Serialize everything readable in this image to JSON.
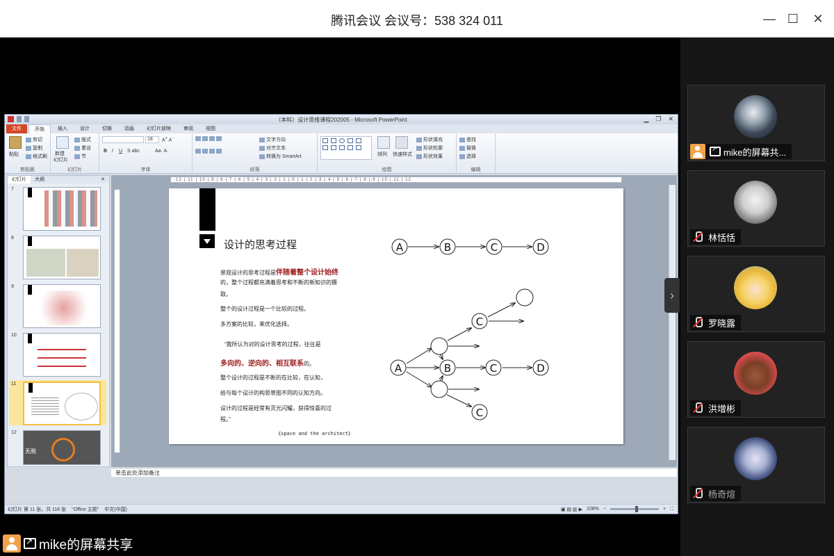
{
  "window": {
    "title": "腾讯会议 会议号：538 324 011",
    "minimize": "—",
    "maximize": "☐",
    "close": "✕"
  },
  "ppt": {
    "title": "（本科）设计思维课程202005 - Microsoft PowerPoint",
    "tabs": [
      "文件",
      "开始",
      "插入",
      "设计",
      "切换",
      "动画",
      "幻灯片放映",
      "审阅",
      "视图"
    ],
    "ribbon": {
      "clipboard": {
        "label": "剪贴板",
        "paste": "粘贴",
        "cut": "剪切",
        "copy": "复制",
        "format": "格式刷"
      },
      "slides": {
        "label": "幻灯片",
        "new": "新建",
        "new2": "幻灯片",
        "layout": "版式",
        "reset": "重设",
        "section": "节"
      },
      "font": {
        "label": "字体",
        "size": "18"
      },
      "paragraph": {
        "label": "段落",
        "dir": "文字方向",
        "align": "对齐文本",
        "smartart": "转换为 SmartArt"
      },
      "drawing": {
        "label": "绘图",
        "arrange": "排列",
        "quick": "快速样式",
        "fill": "形状填充",
        "outline": "形状轮廓",
        "effect": "形状效果"
      },
      "editing": {
        "label": "编辑",
        "find": "查找",
        "replace": "替换",
        "select": "选择"
      }
    },
    "leftpane": {
      "tabs": [
        "幻灯片",
        "大纲"
      ],
      "close": "✕",
      "thumbs": [
        {
          "num": "7"
        },
        {
          "num": "8"
        },
        {
          "num": "9"
        },
        {
          "num": "10"
        },
        {
          "num": "11"
        },
        {
          "num": "12",
          "text": "无限"
        }
      ]
    },
    "ruler": "·12·|·11·|·10·|·9·|·8·|·7·|·6·|·5·|·4·|·3·|·2·|·1·|·0·|·1·|·2·|·3·|·4·|·5·|·6·|·7·|·8·|·9·|·10·|·11·|·12·",
    "slide": {
      "title": "设计的思考过程",
      "l1a": "景观设计的思考过程是",
      "l1b": "伴随着整个设计始终",
      "l2": "的，整个过程都充满着思考和不断的新知识的摄",
      "l3": "取。",
      "l4": "整个的设计过程是一个比较的过程。",
      "l5": "多方案的比较，来优化选择。",
      "l6": "“我所认为对的设计思考的过程，往往是",
      "l7a": "多向的、逆向的、相互联系",
      "l7b": "的。",
      "l8": "整个设计的过程是不断的在比较，在认知，",
      "l9": "给与每个设计的构思草图不同的认知方向。",
      "l10": "设计的过程是经常有灵光闪耀，获得惊喜的过",
      "l11": "程。”",
      "cite": "《space and the architect》",
      "nodes": {
        "a": "A",
        "b": "B",
        "c": "C",
        "d": "D"
      }
    },
    "notes": "单击此处添加备注",
    "status": {
      "slide": "幻灯片 第 11 张，共 116 张",
      "theme": "\"Office 主题\"",
      "lang": "中文(中国)",
      "zoom": "108%"
    }
  },
  "sharer": {
    "label": "mike的屏幕共享"
  },
  "participants": [
    {
      "name": "mike的屏幕共...",
      "type": "sharer"
    },
    {
      "name": "林恬恬",
      "type": "muted"
    },
    {
      "name": "罗晓露",
      "type": "muted"
    },
    {
      "name": "洪增彬",
      "type": "muted"
    },
    {
      "name": "杨奇煊",
      "type": "muted-dim"
    }
  ]
}
